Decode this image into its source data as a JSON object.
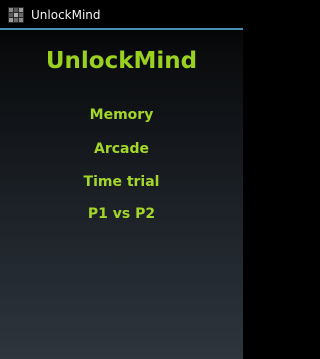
{
  "app": {
    "title": "UnlockMind",
    "icon": "checker-grid-icon"
  },
  "main": {
    "heading": "UnlockMind",
    "menu": [
      {
        "label": "Memory"
      },
      {
        "label": "Arcade"
      },
      {
        "label": "Time trial"
      },
      {
        "label": "P1 vs P2"
      }
    ]
  },
  "colors": {
    "accent_green": "#9ad11f",
    "titlebar_divider": "#4c8fb5",
    "titlebar_text": "#f2f2f2"
  }
}
